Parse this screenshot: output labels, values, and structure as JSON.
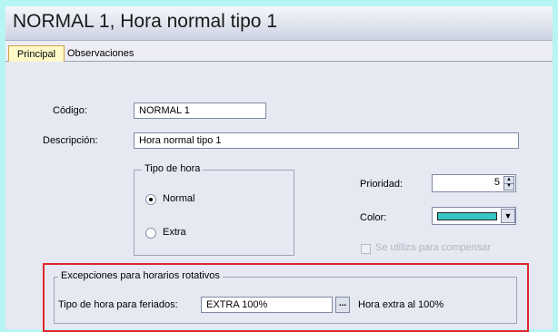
{
  "window": {
    "title": "NORMAL 1, Hora normal tipo 1"
  },
  "tabs": [
    {
      "label": "Principal",
      "active": true
    },
    {
      "label": "Observaciones",
      "active": false
    }
  ],
  "form": {
    "codigo_label": "Código:",
    "codigo_value": "NORMAL 1",
    "descripcion_label": "Descripción:",
    "descripcion_value": "Hora normal tipo 1",
    "tipo_hora": {
      "legend": "Tipo de hora",
      "options": [
        {
          "label": "Normal",
          "selected": true
        },
        {
          "label": "Extra",
          "selected": false
        }
      ]
    },
    "prioridad_label": "Prioridad:",
    "prioridad_value": "5",
    "color_label": "Color:",
    "color_value": "#34c6c3",
    "compensar_label": "Se utiliza para compensar",
    "compensar_checked": false,
    "excepciones": {
      "legend": "Excepciones para horarios rotativos",
      "feriados_label": "Tipo de hora para feriados:",
      "feriados_value": "EXTRA 100%",
      "lookup_button": "...",
      "feriados_desc": "Hora extra al 100%"
    }
  },
  "highlight_color": "#e0262c"
}
